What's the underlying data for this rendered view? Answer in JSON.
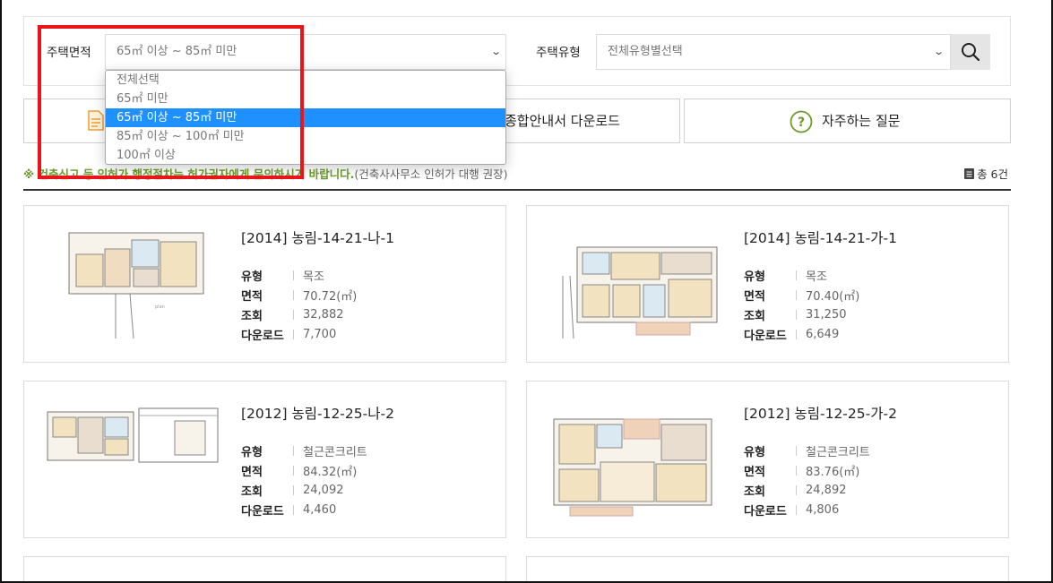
{
  "filters": {
    "area_label": "주택면적",
    "area_selected": "65㎡ 이상 ~ 85㎡ 미만",
    "area_options": [
      "전체선택",
      "65㎡ 미만",
      "65㎡ 이상 ~ 85㎡ 미만",
      "85㎡ 이상 ~ 100㎡ 미만",
      "100㎡ 이상"
    ],
    "area_selected_index": 2,
    "type_label": "주택유형",
    "type_selected": "전체유형별선택"
  },
  "buttons": {
    "download_label": "종합안내서 다운로드",
    "faq_label": "자주하는 질문"
  },
  "notice": {
    "main": "※ 건축신고 등 인허가 행정절차는 허가권자에게 문의하시기 바랍니다.",
    "sub": "(건축사사무소 인허가 대행 권장)"
  },
  "total": "총 6건",
  "spec_labels": {
    "type": "유형",
    "area": "면적",
    "views": "조회",
    "downloads": "다운로드"
  },
  "cards": [
    {
      "title": "[2014] 농림-14-21-나-1",
      "type": "목조",
      "area": "70.72(㎡)",
      "views": "32,882",
      "downloads": "7,700"
    },
    {
      "title": "[2014] 농림-14-21-가-1",
      "type": "목조",
      "area": "70.40(㎡)",
      "views": "31,250",
      "downloads": "6,649"
    },
    {
      "title": "[2012] 농림-12-25-나-2",
      "type": "철근콘크리트",
      "area": "84.32(㎡)",
      "views": "24,092",
      "downloads": "4,460"
    },
    {
      "title": "[2012] 농림-12-25-가-2",
      "type": "철근콘크리트",
      "area": "83.76(㎡)",
      "views": "24,892",
      "downloads": "4,806"
    }
  ],
  "colors": {
    "accent_green": "#6c9a2c",
    "selection_blue": "#1e90ff",
    "highlight_red": "#e8151b",
    "icon_orange": "#e8a23a"
  },
  "icons": {
    "search": "search-icon",
    "document": "document-icon",
    "faq": "question-circle-icon",
    "list": "list-icon",
    "chevron": "chevron-down-icon"
  }
}
